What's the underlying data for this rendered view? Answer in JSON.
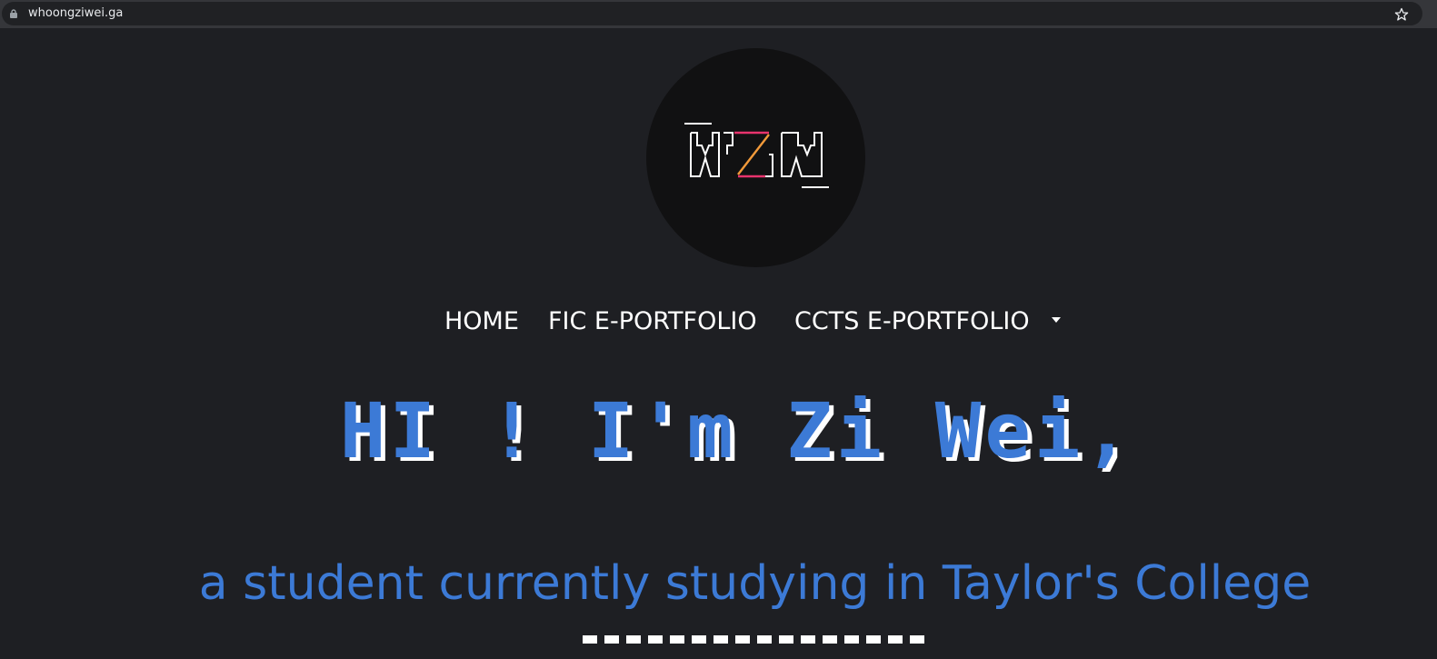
{
  "browser": {
    "url": "whoongziwei.ga",
    "lock_icon": "lock-icon",
    "bookmark_icon": "star-icon"
  },
  "logo": {
    "letters": "WZW",
    "colors": {
      "stroke": "#ffffff",
      "accent_pink": "#e8336d",
      "accent_orange": "#f29a3a",
      "circle": "#111112"
    }
  },
  "nav": {
    "home": "HOME",
    "fic": "FIC E-PORTFOLIO",
    "ccts": "CCTS E-PORTFOLIO",
    "dropdown_icon": "caret-down-icon"
  },
  "hero": {
    "greeting": "HI ! I'm Zi Wei,",
    "subtitle": "a student currently studying in Taylor's College"
  },
  "colors": {
    "background": "#1e1f23",
    "accent_blue": "#3c7ad6",
    "text": "#ffffff"
  }
}
